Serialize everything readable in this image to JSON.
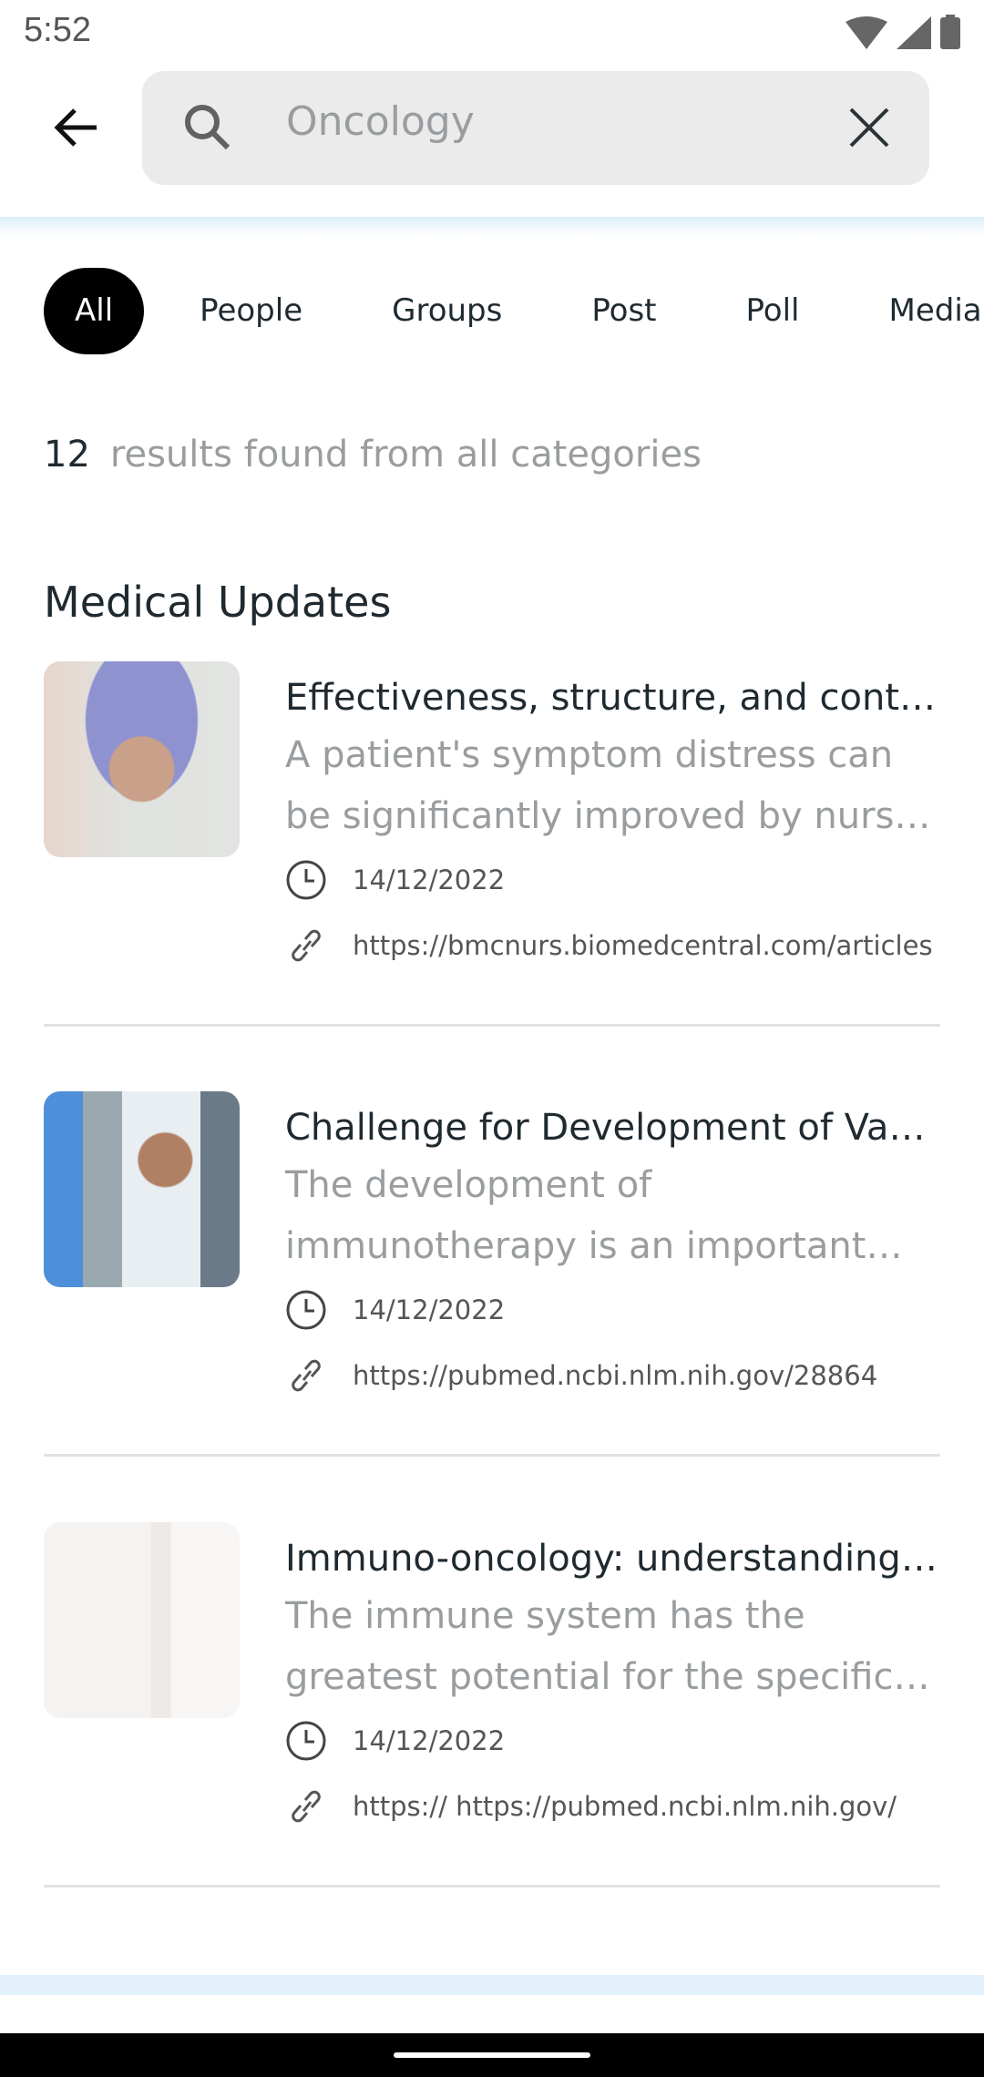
{
  "status_bar": {
    "time": "5:52"
  },
  "search": {
    "value": "Oncology"
  },
  "tabs": [
    {
      "label": "All",
      "active": true
    },
    {
      "label": "People"
    },
    {
      "label": "Groups"
    },
    {
      "label": "Post"
    },
    {
      "label": "Poll"
    },
    {
      "label": "Media"
    }
  ],
  "results": {
    "count": "12",
    "text": "results found from all categories"
  },
  "section_title": "Medical Updates",
  "items": [
    {
      "title": "Effectiveness, structure, and content of nurse counseling in oncology",
      "description": "A patient's symptom distress can be significantly improved by nurse counseling",
      "date": "14/12/2022",
      "link": "https://bmcnurs.biomedcentral.com/articles"
    },
    {
      "title": "Challenge for Development of Vaccines",
      "description": "The development of immunotherapy is an important breakthrough",
      "date": "14/12/2022",
      "link": "https://pubmed.ncbi.nlm.nih.gov/28864"
    },
    {
      "title": "Immuno-oncology: understanding the function",
      "description": "The immune system has the greatest potential for the specific destruction",
      "date": "14/12/2022",
      "link": "https:// https://pubmed.ncbi.nlm.nih.gov/"
    }
  ],
  "colors": {
    "accent_band": "#dceffa",
    "chip_active": "#000000",
    "muted_text": "#9a9d9f"
  }
}
